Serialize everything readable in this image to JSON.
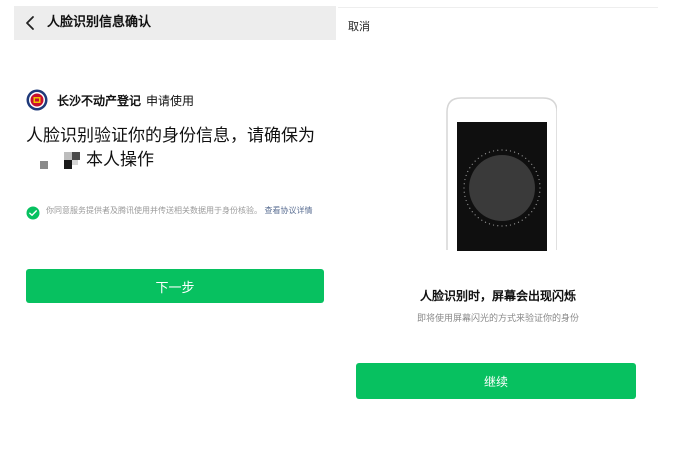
{
  "left_panel": {
    "header_title": "人脸识别信息确认",
    "org_name": "长沙不动产登记",
    "org_action": "申请使用",
    "heading_line1": "人脸识别验证你的身份信息，请确保为",
    "heading_line2_suffix": "本人操作",
    "agreement_text": "你同意服务提供者及腾讯使用并传送相关数据用于身份核验。",
    "agreement_link": "查看协议详情",
    "next_button_label": "下一步"
  },
  "right_panel": {
    "cancel_label": "取消",
    "flash_title": "人脸识别时，屏幕会出现闪烁",
    "flash_subtitle": "即将使用屏幕闪光的方式来验证你的身份",
    "continue_button_label": "继续"
  },
  "colors": {
    "accent_green": "#07c160",
    "header_bg": "#ededed",
    "link_blue": "#5b6f93"
  },
  "icons": {
    "back": "chevron-left-icon",
    "check": "check-circle-icon",
    "org_logo": "seal-logo"
  }
}
